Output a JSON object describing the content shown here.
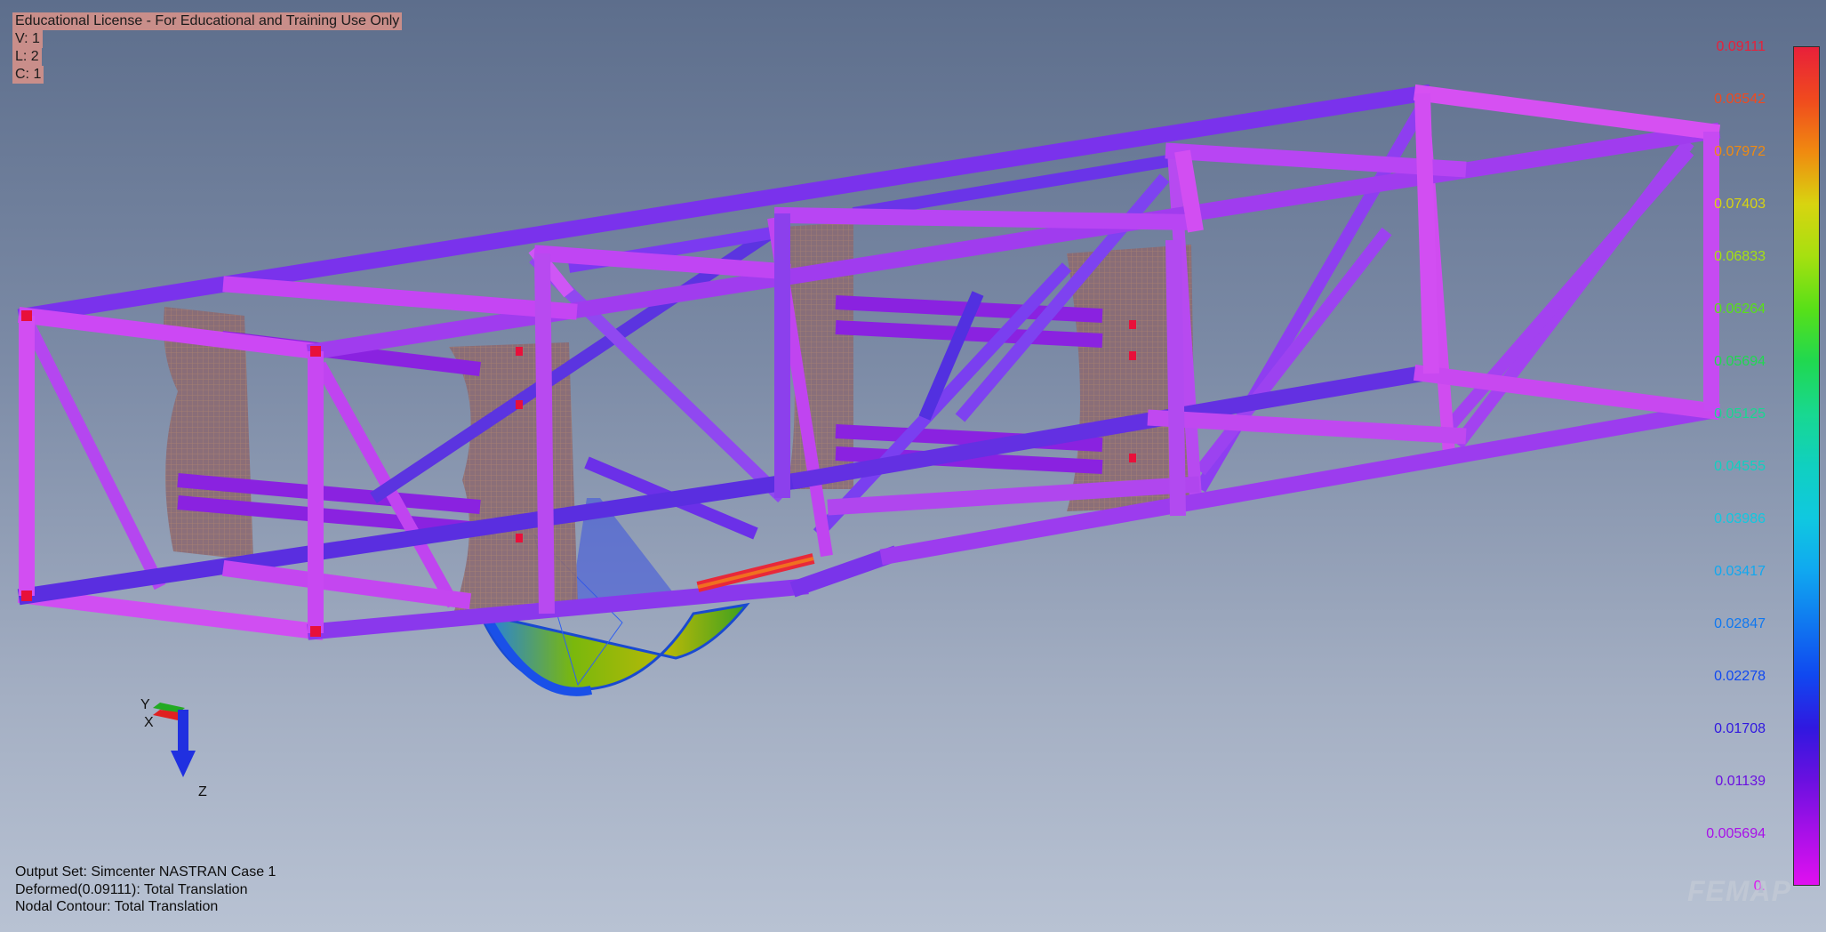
{
  "license": {
    "line1": "Educational License - For Educational and Training Use Only",
    "line2": "V: 1",
    "line3": "L: 2",
    "line4": "C: 1"
  },
  "output": {
    "set": "Output Set: Simcenter NASTRAN Case 1",
    "deformed": "Deformed(0.09111): Total Translation",
    "contour": "Nodal Contour: Total Translation"
  },
  "legend": {
    "values": [
      "0.09111",
      "0.08542",
      "0.07972",
      "0.07403",
      "0.06833",
      "0.06264",
      "0.05694",
      "0.05125",
      "0.04555",
      "0.03986",
      "0.03417",
      "0.02847",
      "0.02278",
      "0.01708",
      "0.01139",
      "0.005694",
      "0."
    ],
    "colors": [
      "#e8203a",
      "#f04a1e",
      "#f08a10",
      "#d8d410",
      "#a6e010",
      "#58e018",
      "#20d850",
      "#18d890",
      "#10d0c0",
      "#10c8e0",
      "#10a8f0",
      "#1078f0",
      "#1048f0",
      "#3018e0",
      "#6a10e0",
      "#a810e8",
      "#e010f0"
    ]
  },
  "triad": {
    "x": "X",
    "y": "Y",
    "z": "Z"
  },
  "watermark": "FEMAP",
  "colors": {
    "beam_pink": "#d84bf0",
    "beam_magenta": "#e040ff",
    "beam_violet": "#7a2ee8",
    "beam_blue": "#4a2ad8",
    "panel_brown": "#8a6a78"
  }
}
